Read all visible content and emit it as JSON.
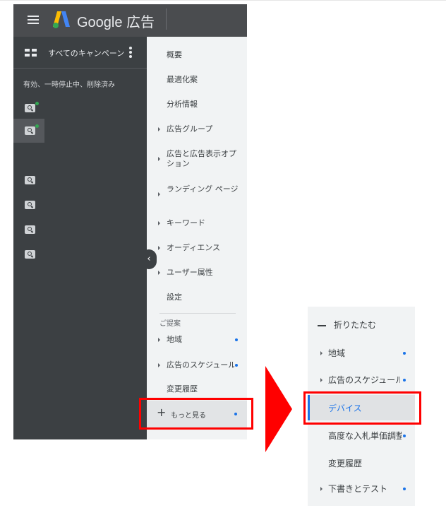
{
  "header": {
    "product_name": "Google 広告"
  },
  "campaigns": {
    "title": "すべてのキャンペーン",
    "status_filter": "有効、一時停止中、削除済み",
    "items": [
      {
        "icon": "search-campaign-icon",
        "active": true,
        "selected": false
      },
      {
        "icon": "search-campaign-icon",
        "active": true,
        "selected": true
      },
      {
        "icon": "search-campaign-icon",
        "active": false,
        "selected": false
      },
      {
        "icon": "search-campaign-icon",
        "active": false,
        "selected": false
      },
      {
        "icon": "search-campaign-icon",
        "active": false,
        "selected": false
      },
      {
        "icon": "search-campaign-icon",
        "active": false,
        "selected": false
      }
    ]
  },
  "nav": {
    "items": [
      {
        "label": "概要"
      },
      {
        "label": "最適化案"
      },
      {
        "label": "分析情報"
      },
      {
        "label": "広告グループ"
      },
      {
        "label": "広告と広告表示オプション"
      },
      {
        "label": "ランディング ページ"
      },
      {
        "label": "キーワード"
      },
      {
        "label": "オーディエンス"
      },
      {
        "label": "ユーザー属性"
      },
      {
        "label": "設定"
      }
    ],
    "section_label": "ご提案",
    "suggestions": [
      {
        "label": "地域"
      },
      {
        "label": "広告のスケジュール"
      },
      {
        "label": "変更履歴"
      }
    ],
    "more_label": "もっと見る"
  },
  "expanded_panel": {
    "collapse_label": "折りたたむ",
    "items": [
      {
        "label": "地域"
      },
      {
        "label": "広告のスケジュール"
      },
      {
        "label": "デバイス"
      },
      {
        "label": "高度な入札単価調整"
      },
      {
        "label": "変更履歴"
      },
      {
        "label": "下書きとテスト"
      }
    ]
  },
  "colors": {
    "accent": "#1a73e8",
    "highlight": "#ff0000",
    "dark_bg": "#3c4043",
    "active_dot": "#34a853"
  }
}
